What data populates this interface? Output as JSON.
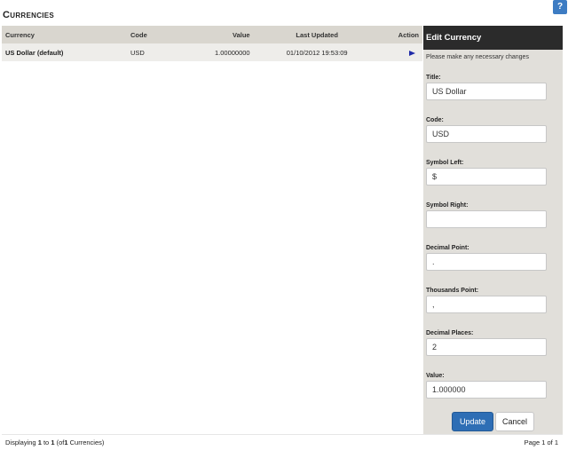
{
  "page": {
    "title": "Currencies",
    "help_label": "?"
  },
  "table": {
    "headers": {
      "currency": "Currency",
      "code": "Code",
      "value": "Value",
      "last_updated": "Last Updated",
      "action": "Action"
    },
    "rows": [
      {
        "title": "US Dollar (default)",
        "code": "USD",
        "value": "1.00000000",
        "last_updated": "01/10/2012 19:53:09",
        "action_icon": "play-icon"
      }
    ]
  },
  "edit": {
    "heading": "Edit Currency",
    "subtitle": "Please make any necessary changes",
    "fields": {
      "title": {
        "label": "Title:",
        "value": "US Dollar"
      },
      "code": {
        "label": "Code:",
        "value": "USD"
      },
      "symbol_left": {
        "label": "Symbol Left:",
        "value": "$"
      },
      "symbol_right": {
        "label": "Symbol Right:",
        "value": ""
      },
      "decimal_point": {
        "label": "Decimal Point:",
        "value": "."
      },
      "thousands_point": {
        "label": "Thousands Point:",
        "value": ","
      },
      "decimal_places": {
        "label": "Decimal Places:",
        "value": "2"
      },
      "value": {
        "label": "Value:",
        "value": "1.000000"
      }
    },
    "update_label": "Update",
    "cancel_label": "Cancel"
  },
  "footer": {
    "displaying_prefix": "Displaying",
    "from": "1",
    "to_word": "to",
    "to": "1",
    "of_prefix": "(of",
    "total": "1",
    "of_suffix": "Currencies)",
    "page_text": "Page 1 of 1"
  },
  "colors": {
    "accent": "#2e6eb5",
    "header_dark": "#2b2b2b",
    "panel_bg": "#e1dfda",
    "table_header": "#d9d6cf",
    "row_bg": "#eeedea",
    "action_icon": "#1f2aa8"
  }
}
